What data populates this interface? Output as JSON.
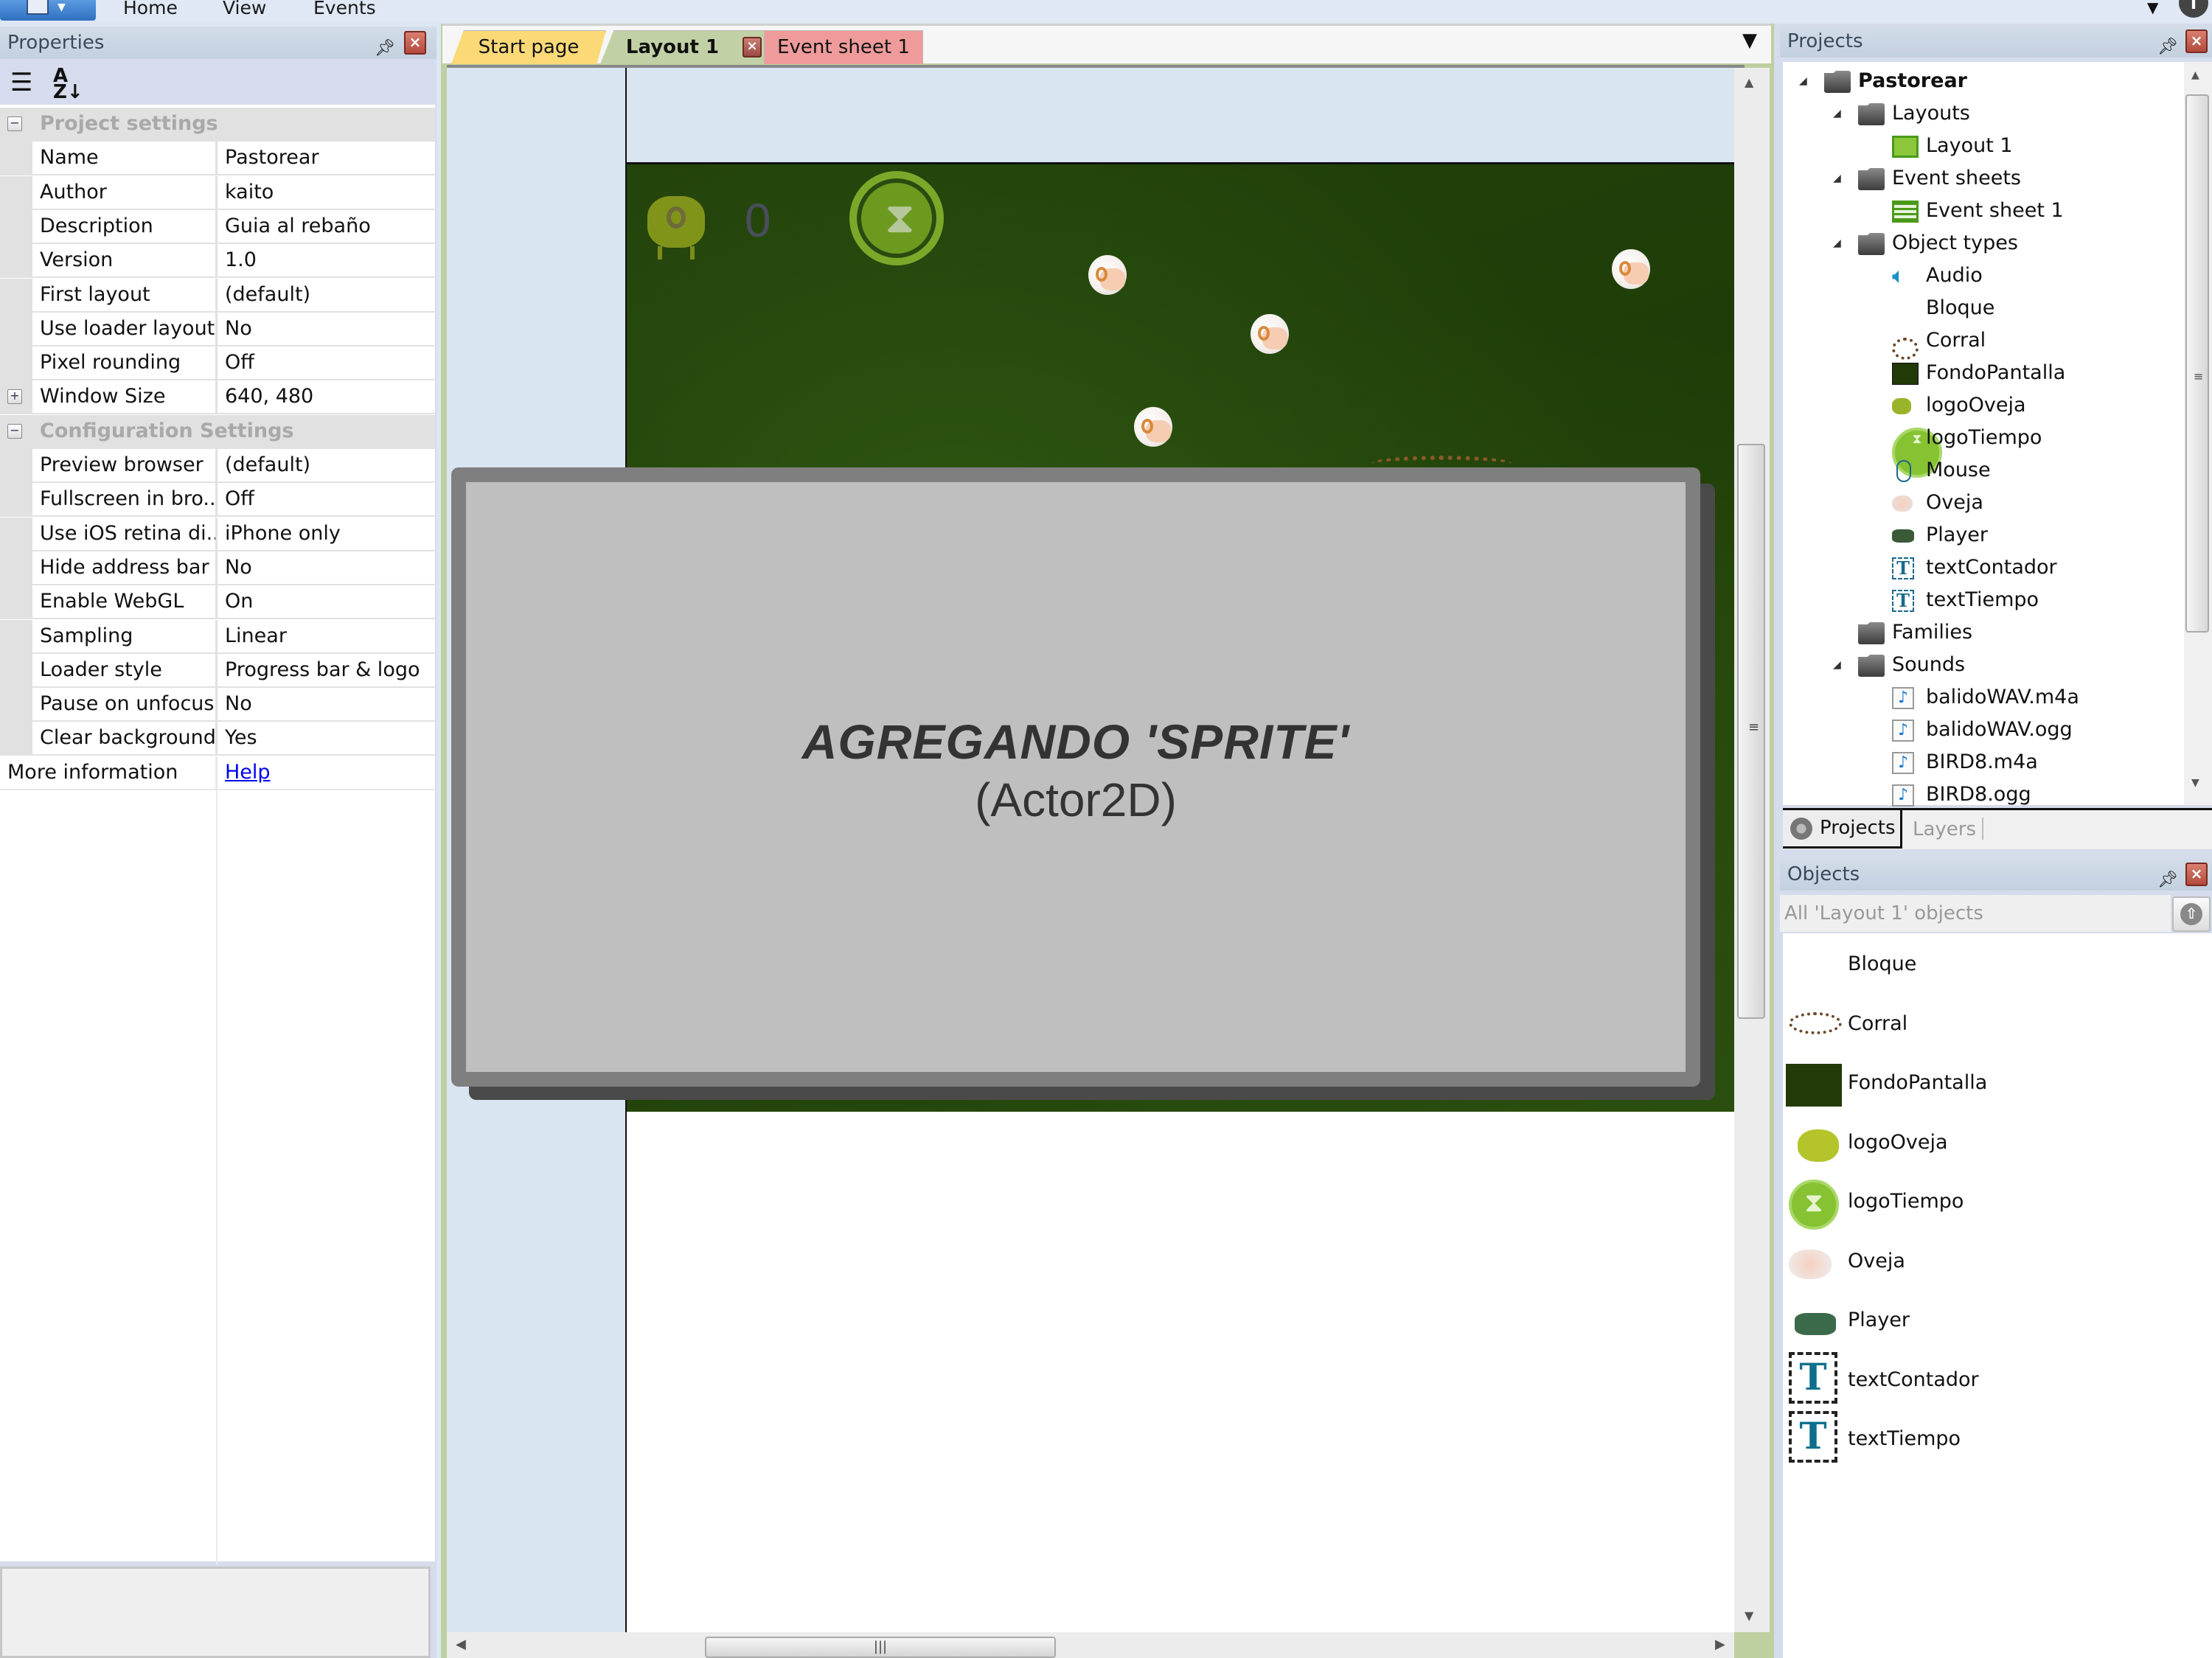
{
  "ribbon": {
    "menu": [
      "Home",
      "View",
      "Events"
    ],
    "help_label": "i"
  },
  "properties": {
    "title": "Properties",
    "categories": [
      {
        "label": "Project settings",
        "rows": [
          {
            "name": "Name",
            "value": "Pastorear"
          },
          {
            "name": "Author",
            "value": "kaito"
          },
          {
            "name": "Description",
            "value": "Guia al rebaño"
          },
          {
            "name": "Version",
            "value": "1.0"
          },
          {
            "name": "First layout",
            "value": "(default)"
          },
          {
            "name": "Use loader layout",
            "value": "No"
          },
          {
            "name": "Pixel rounding",
            "value": "Off"
          },
          {
            "name": "Window Size",
            "value": "640, 480",
            "expandable": true
          }
        ]
      },
      {
        "label": "Configuration Settings",
        "rows": [
          {
            "name": "Preview browser",
            "value": "(default)"
          },
          {
            "name": "Fullscreen in bro...",
            "value": "Off"
          },
          {
            "name": "Use iOS retina di...",
            "value": "iPhone only"
          },
          {
            "name": "Hide address bar",
            "value": "No"
          },
          {
            "name": "Enable WebGL",
            "value": "On"
          },
          {
            "name": "Sampling",
            "value": "Linear"
          },
          {
            "name": "Loader style",
            "value": "Progress bar & logo"
          },
          {
            "name": "Pause on unfocus",
            "value": "No"
          },
          {
            "name": "Clear background",
            "value": "Yes"
          }
        ]
      }
    ],
    "more_info": {
      "name": "More information",
      "link": "Help"
    }
  },
  "tabs": [
    {
      "label": "Start page",
      "color": "#fbd977"
    },
    {
      "label": "Layout 1",
      "color": "#c2d1a5",
      "active": true
    },
    {
      "label": "Event sheet 1",
      "color": "#f09b9b"
    }
  ],
  "layout_view": {
    "hud_counter": "0",
    "overlay": {
      "title": "AGREGANDO 'SPRITE'",
      "subtitle": "(Actor2D)"
    }
  },
  "projects": {
    "title": "Projects",
    "tree": [
      {
        "label": "Pastorear",
        "level": 0,
        "icon": "folder",
        "expanded": true,
        "bold": true
      },
      {
        "label": "Layouts",
        "level": 1,
        "icon": "folder",
        "expanded": true
      },
      {
        "label": "Layout 1",
        "level": 2,
        "icon": "layout"
      },
      {
        "label": "Event sheets",
        "level": 1,
        "icon": "folder",
        "expanded": true
      },
      {
        "label": "Event sheet 1",
        "level": 2,
        "icon": "event-sheet"
      },
      {
        "label": "Object types",
        "level": 1,
        "icon": "folder",
        "expanded": true
      },
      {
        "label": "Audio",
        "level": 2,
        "icon": "audio"
      },
      {
        "label": "Bloque",
        "level": 2,
        "icon": "none"
      },
      {
        "label": "Corral",
        "level": 2,
        "icon": "corral"
      },
      {
        "label": "FondoPantalla",
        "level": 2,
        "icon": "tiled-bg"
      },
      {
        "label": "logoOveja",
        "level": 2,
        "icon": "sheep-logo"
      },
      {
        "label": "logoTiempo",
        "level": 2,
        "icon": "timer-logo"
      },
      {
        "label": "Mouse",
        "level": 2,
        "icon": "mouse"
      },
      {
        "label": "Oveja",
        "level": 2,
        "icon": "sheep"
      },
      {
        "label": "Player",
        "level": 2,
        "icon": "dog"
      },
      {
        "label": "textContador",
        "level": 2,
        "icon": "text"
      },
      {
        "label": "textTiempo",
        "level": 2,
        "icon": "text"
      },
      {
        "label": "Families",
        "level": 1,
        "icon": "folder"
      },
      {
        "label": "Sounds",
        "level": 1,
        "icon": "folder",
        "expanded": true
      },
      {
        "label": "balidoWAV.m4a",
        "level": 2,
        "icon": "sound-file"
      },
      {
        "label": "balidoWAV.ogg",
        "level": 2,
        "icon": "sound-file"
      },
      {
        "label": "BIRD8.m4a",
        "level": 2,
        "icon": "sound-file"
      },
      {
        "label": "BIRD8.ogg",
        "level": 2,
        "icon": "sound-file"
      }
    ],
    "bottom_tabs": [
      "Projects",
      "Layers"
    ]
  },
  "objects": {
    "title": "Objects",
    "filter_placeholder": "All 'Layout 1' objects",
    "items": [
      {
        "label": "Bloque",
        "icon": "none"
      },
      {
        "label": "Corral",
        "icon": "corral"
      },
      {
        "label": "FondoPantalla",
        "icon": "tiled-bg"
      },
      {
        "label": "logoOveja",
        "icon": "sheep-logo"
      },
      {
        "label": "logoTiempo",
        "icon": "timer-logo"
      },
      {
        "label": "Oveja",
        "icon": "sheep"
      },
      {
        "label": "Player",
        "icon": "dog"
      },
      {
        "label": "textContador",
        "icon": "text"
      },
      {
        "label": "textTiempo",
        "icon": "text"
      }
    ]
  }
}
